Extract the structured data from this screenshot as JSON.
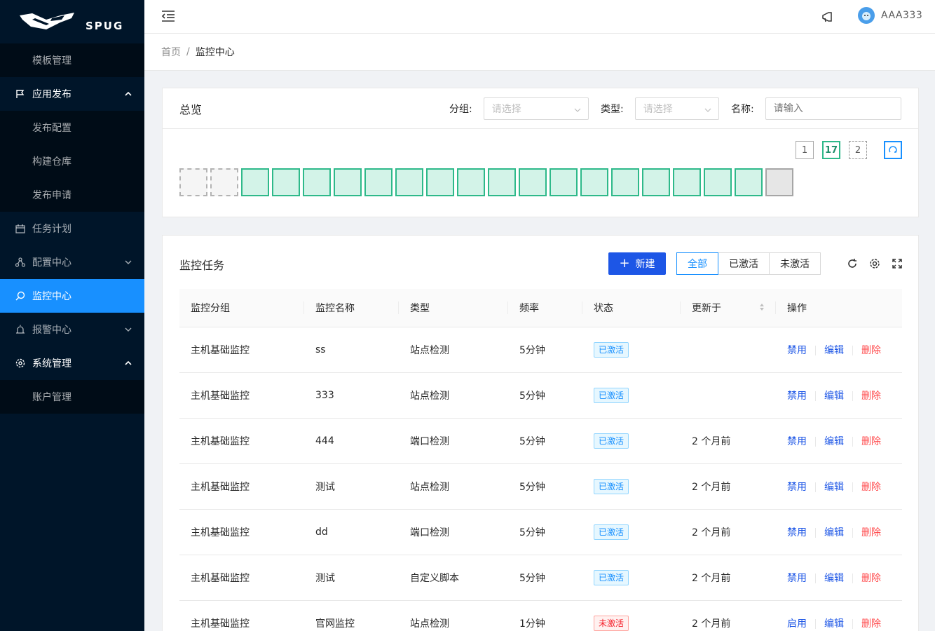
{
  "logo": {
    "text": "SPUG"
  },
  "sidebar": {
    "items": [
      {
        "label": "模板管理",
        "type": "sub"
      },
      {
        "label": "应用发布",
        "type": "parent-open",
        "icon": "flag-icon"
      },
      {
        "label": "发布配置",
        "type": "sub"
      },
      {
        "label": "构建仓库",
        "type": "sub"
      },
      {
        "label": "发布申请",
        "type": "sub"
      },
      {
        "label": "任务计划",
        "type": "item",
        "icon": "calendar-icon"
      },
      {
        "label": "配置中心",
        "type": "parent",
        "icon": "cluster-icon"
      },
      {
        "label": "监控中心",
        "type": "active",
        "icon": "monitor-icon"
      },
      {
        "label": "报警中心",
        "type": "parent",
        "icon": "alarm-icon"
      },
      {
        "label": "系统管理",
        "type": "parent-open",
        "icon": "setting-icon"
      },
      {
        "label": "账户管理",
        "type": "sub"
      }
    ]
  },
  "header": {
    "username": "AAA333"
  },
  "breadcrumb": {
    "home": "首页",
    "separator": "/",
    "current": "监控中心"
  },
  "overview": {
    "title": "总览",
    "filters": {
      "group_label": "分组:",
      "group_placeholder": "请选择",
      "type_label": "类型:",
      "type_placeholder": "请选择",
      "name_label": "名称:",
      "name_placeholder": "请输入"
    },
    "counters": {
      "normal": "1",
      "ok": "17",
      "pending": "2"
    }
  },
  "tasks": {
    "title": "监控任务",
    "new_button": "新建",
    "filter_all": "全部",
    "filter_active": "已激活",
    "filter_inactive": "未激活",
    "columns": [
      "监控分组",
      "监控名称",
      "类型",
      "频率",
      "状态",
      "更新于",
      "操作"
    ],
    "rows": [
      {
        "group": "主机基础监控",
        "name": "ss",
        "type": "站点检测",
        "freq": "5分钟",
        "status": "已激活",
        "active": true,
        "updated": "",
        "toggle": "禁用"
      },
      {
        "group": "主机基础监控",
        "name": "333",
        "type": "站点检测",
        "freq": "5分钟",
        "status": "已激活",
        "active": true,
        "updated": "",
        "toggle": "禁用"
      },
      {
        "group": "主机基础监控",
        "name": "444",
        "type": "端口检测",
        "freq": "5分钟",
        "status": "已激活",
        "active": true,
        "updated": "2 个月前",
        "toggle": "禁用"
      },
      {
        "group": "主机基础监控",
        "name": "测试",
        "type": "站点检测",
        "freq": "5分钟",
        "status": "已激活",
        "active": true,
        "updated": "2 个月前",
        "toggle": "禁用"
      },
      {
        "group": "主机基础监控",
        "name": "dd",
        "type": "端口检测",
        "freq": "5分钟",
        "status": "已激活",
        "active": true,
        "updated": "2 个月前",
        "toggle": "禁用"
      },
      {
        "group": "主机基础监控",
        "name": "测试",
        "type": "自定义脚本",
        "freq": "5分钟",
        "status": "已激活",
        "active": true,
        "updated": "2 个月前",
        "toggle": "禁用"
      },
      {
        "group": "主机基础监控",
        "name": "官网监控",
        "type": "站点检测",
        "freq": "1分钟",
        "status": "未激活",
        "active": false,
        "updated": "2 个月前",
        "toggle": "启用"
      }
    ],
    "edit_label": "编辑",
    "delete_label": "删除"
  },
  "colors": {
    "primary": "#1890ff",
    "sidebar_bg": "#001529",
    "ok_green": "#2eb98a",
    "danger": "#ff4d4f"
  }
}
